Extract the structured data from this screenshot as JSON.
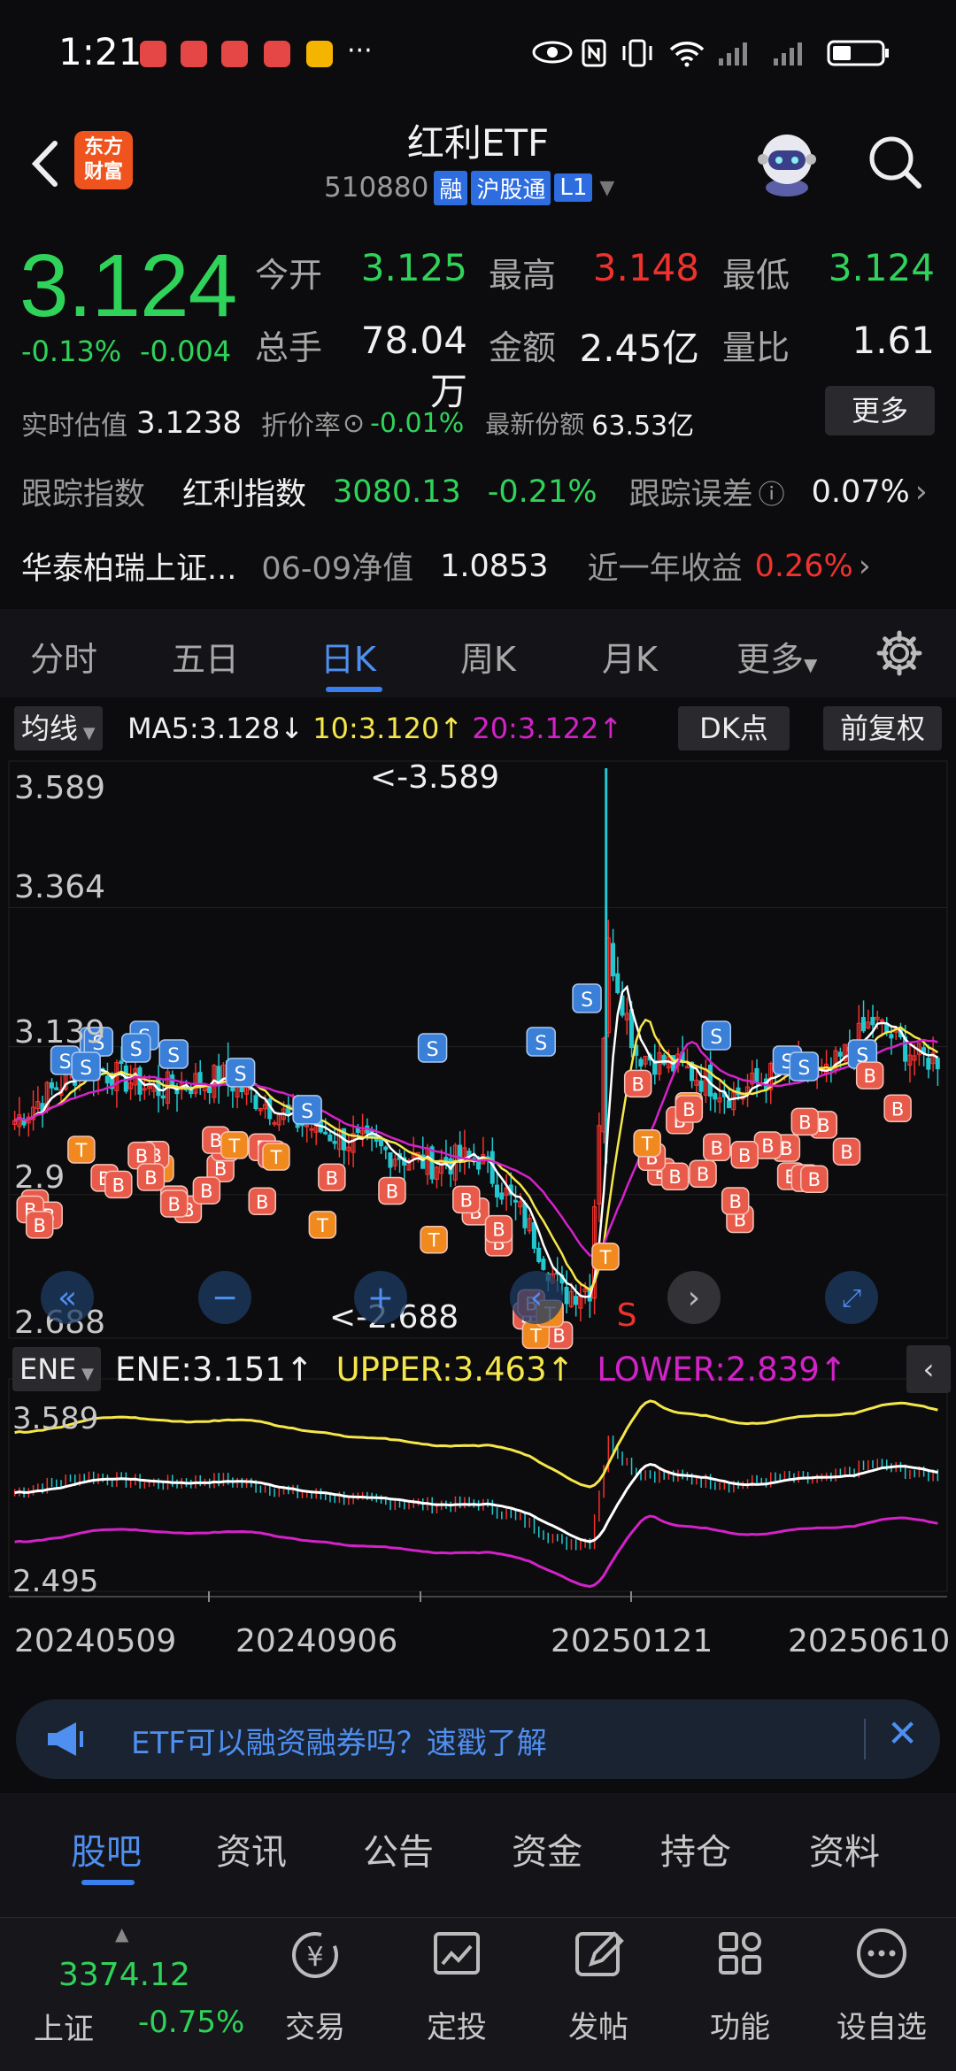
{
  "status_bar": {
    "time": "1:21",
    "more": "···"
  },
  "header": {
    "title": "红利ETF",
    "code": "510880",
    "tags": [
      "融",
      "沪股通",
      "L1"
    ],
    "logo_text": [
      "东方",
      "财富"
    ]
  },
  "quote": {
    "price": "3.124",
    "change_pct": "-0.13%",
    "change_val": "-0.004",
    "open_label": "今开",
    "open": "3.125",
    "high_label": "最高",
    "high": "3.148",
    "low_label": "最低",
    "low": "3.124",
    "volume_label": "总手",
    "volume": "78.04万",
    "amount_label": "金额",
    "amount": "2.45亿",
    "ratio_label": "量比",
    "ratio": "1.61",
    "est_label": "实时估值",
    "est": "3.1238",
    "discount_label": "折价率",
    "discount": "-0.01%",
    "shares_label": "最新份额",
    "shares": "63.53亿",
    "more_button": "更多",
    "track_label": "跟踪指数",
    "track_index": "红利指数",
    "track_value": "3080.13",
    "track_change": "-0.21%",
    "error_label": "跟踪误差",
    "error_value": "0.07%",
    "fund_name": "华泰柏瑞上证...",
    "nav_label": "06-09净值",
    "nav_value": "1.0853",
    "yield_label": "近一年收益",
    "yield_value": "0.26%"
  },
  "tabs": {
    "items": [
      "分时",
      "五日",
      "日K",
      "周K",
      "月K",
      "更多"
    ],
    "active": "日K"
  },
  "chart_header": {
    "ma_button": "均线",
    "ma5": "MA5:3.128↓",
    "ma10": "10:3.120↑",
    "ma20": "20:3.122↑",
    "dk_button": "DK点",
    "fq_button": "前复权"
  },
  "chart_data": [
    {
      "type": "candlestick",
      "title": "日K",
      "y_ticks": [
        "3.589",
        "3.364",
        "3.139",
        "2.9",
        "2.688"
      ],
      "ylim": [
        2.688,
        3.589
      ],
      "max_label": "<-3.589",
      "min_label": "<-2.688",
      "marker_labels": [
        "S",
        "B",
        "T"
      ],
      "center_label": "S",
      "colors": {
        "up": "#f0322e",
        "down": "#22c7cf",
        "ma5": "#ffffff",
        "ma10": "#f5e64a",
        "ma20": "#d322c8"
      }
    },
    {
      "type": "line",
      "title": "ENE",
      "series": [
        {
          "name": "ENE",
          "last": "3.151"
        },
        {
          "name": "UPPER",
          "last": "3.463"
        },
        {
          "name": "LOWER",
          "last": "2.839"
        }
      ],
      "y_ticks": [
        "3.589",
        "2.495"
      ],
      "ylim": [
        2.495,
        3.589
      ],
      "x_ticks": [
        "20240509",
        "20240906",
        "20250121",
        "20250610"
      ]
    }
  ],
  "ene_header": {
    "button": "ENE",
    "ene": "ENE:3.151↑",
    "upper": "UPPER:3.463↑",
    "lower": "LOWER:2.839↑"
  },
  "banner": {
    "text": "ETF可以融资融券吗？速戳了解"
  },
  "info_tabs": {
    "items": [
      "股吧",
      "资讯",
      "公告",
      "资金",
      "持仓",
      "资料"
    ],
    "active": "股吧"
  },
  "bottom_nav": {
    "index_value": "3374.12",
    "index_name": "上证",
    "index_change": "-0.75%",
    "items": [
      "交易",
      "定投",
      "发帖",
      "功能",
      "设自选"
    ]
  }
}
